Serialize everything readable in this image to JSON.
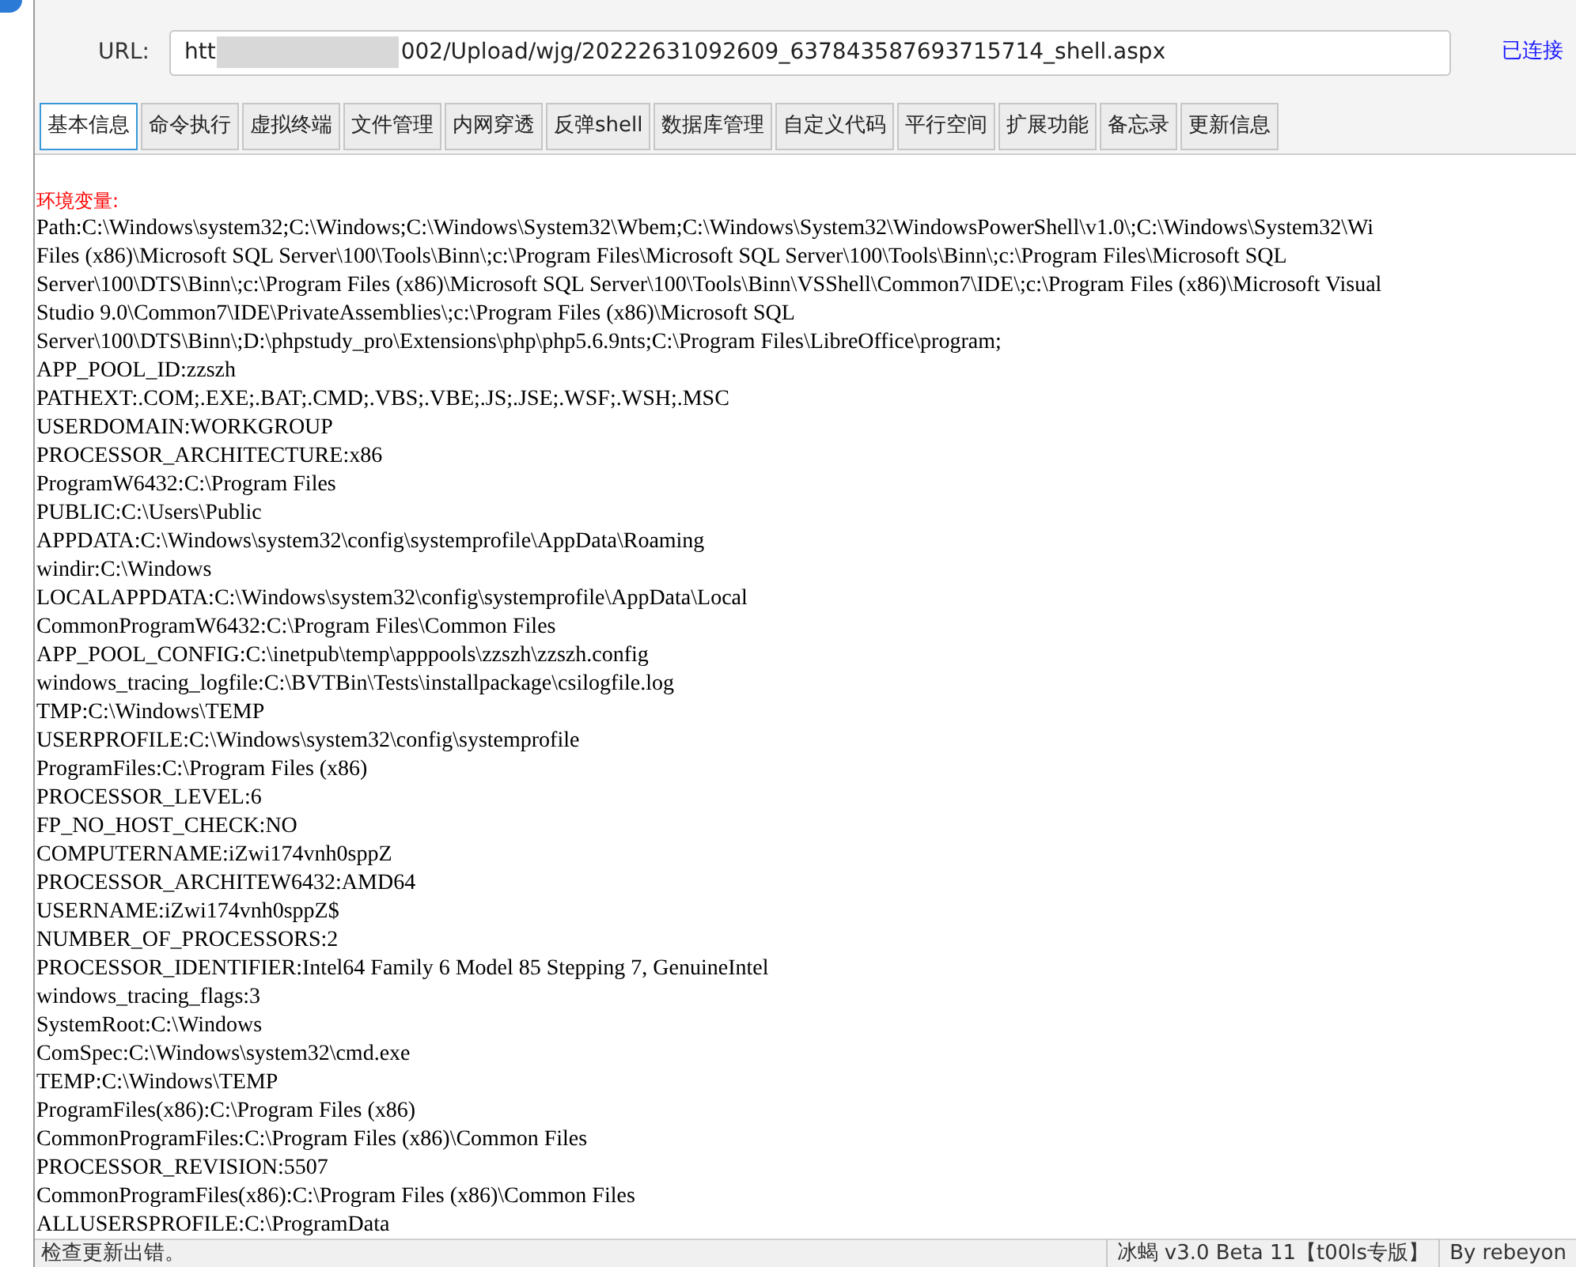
{
  "url": {
    "label": "URL:",
    "prefix": "htt",
    "suffix": "002/Upload/wjg/20222631092609_637843587693715714_shell.aspx",
    "status": "已连接"
  },
  "tabs": [
    {
      "label": "基本信息",
      "selected": true
    },
    {
      "label": "命令执行",
      "selected": false
    },
    {
      "label": "虚拟终端",
      "selected": false
    },
    {
      "label": "文件管理",
      "selected": false
    },
    {
      "label": "内网穿透",
      "selected": false
    },
    {
      "label": "反弹shell",
      "selected": false
    },
    {
      "label": "数据库管理",
      "selected": false
    },
    {
      "label": "自定义代码",
      "selected": false
    },
    {
      "label": "平行空间",
      "selected": false
    },
    {
      "label": "扩展功能",
      "selected": false
    },
    {
      "label": "备忘录",
      "selected": false
    },
    {
      "label": "更新信息",
      "selected": false
    }
  ],
  "env": {
    "heading": "环境变量:",
    "lines": [
      "Path:C:\\Windows\\system32;C:\\Windows;C:\\Windows\\System32\\Wbem;C:\\Windows\\System32\\WindowsPowerShell\\v1.0\\;C:\\Windows\\System32\\Wi",
      "Files (x86)\\Microsoft SQL Server\\100\\Tools\\Binn\\;c:\\Program Files\\Microsoft SQL Server\\100\\Tools\\Binn\\;c:\\Program Files\\Microsoft SQL",
      "Server\\100\\DTS\\Binn\\;c:\\Program Files (x86)\\Microsoft SQL Server\\100\\Tools\\Binn\\VSShell\\Common7\\IDE\\;c:\\Program Files (x86)\\Microsoft Visual",
      "Studio 9.0\\Common7\\IDE\\PrivateAssemblies\\;c:\\Program Files (x86)\\Microsoft SQL",
      "Server\\100\\DTS\\Binn\\;D:\\phpstudy_pro\\Extensions\\php\\php5.6.9nts;C:\\Program Files\\LibreOffice\\program;",
      "APP_POOL_ID:zzszh",
      "PATHEXT:.COM;.EXE;.BAT;.CMD;.VBS;.VBE;.JS;.JSE;.WSF;.WSH;.MSC",
      "USERDOMAIN:WORKGROUP",
      "PROCESSOR_ARCHITECTURE:x86",
      "ProgramW6432:C:\\Program Files",
      "PUBLIC:C:\\Users\\Public",
      "APPDATA:C:\\Windows\\system32\\config\\systemprofile\\AppData\\Roaming",
      "windir:C:\\Windows",
      "LOCALAPPDATA:C:\\Windows\\system32\\config\\systemprofile\\AppData\\Local",
      "CommonProgramW6432:C:\\Program Files\\Common Files",
      "APP_POOL_CONFIG:C:\\inetpub\\temp\\apppools\\zzszh\\zzszh.config",
      "windows_tracing_logfile:C:\\BVTBin\\Tests\\installpackage\\csilogfile.log",
      "TMP:C:\\Windows\\TEMP",
      "USERPROFILE:C:\\Windows\\system32\\config\\systemprofile",
      "ProgramFiles:C:\\Program Files (x86)",
      "PROCESSOR_LEVEL:6",
      "FP_NO_HOST_CHECK:NO",
      "COMPUTERNAME:iZwi174vnh0sppZ",
      "PROCESSOR_ARCHITEW6432:AMD64",
      "USERNAME:iZwi174vnh0sppZ$",
      "NUMBER_OF_PROCESSORS:2",
      "PROCESSOR_IDENTIFIER:Intel64 Family 6 Model 85 Stepping 7, GenuineIntel",
      "windows_tracing_flags:3",
      "SystemRoot:C:\\Windows",
      "ComSpec:C:\\Windows\\system32\\cmd.exe",
      "TEMP:C:\\Windows\\TEMP",
      "ProgramFiles(x86):C:\\Program Files (x86)",
      "CommonProgramFiles:C:\\Program Files (x86)\\Common Files",
      "PROCESSOR_REVISION:5507",
      "CommonProgramFiles(x86):C:\\Program Files (x86)\\Common Files",
      "ALLUSERSPROFILE:C:\\ProgramData"
    ]
  },
  "status_bar": {
    "message": "检查更新出错。",
    "version": "冰蝎 v3.0 Beta 11【t00ls专版】",
    "author": "By rebeyon"
  }
}
